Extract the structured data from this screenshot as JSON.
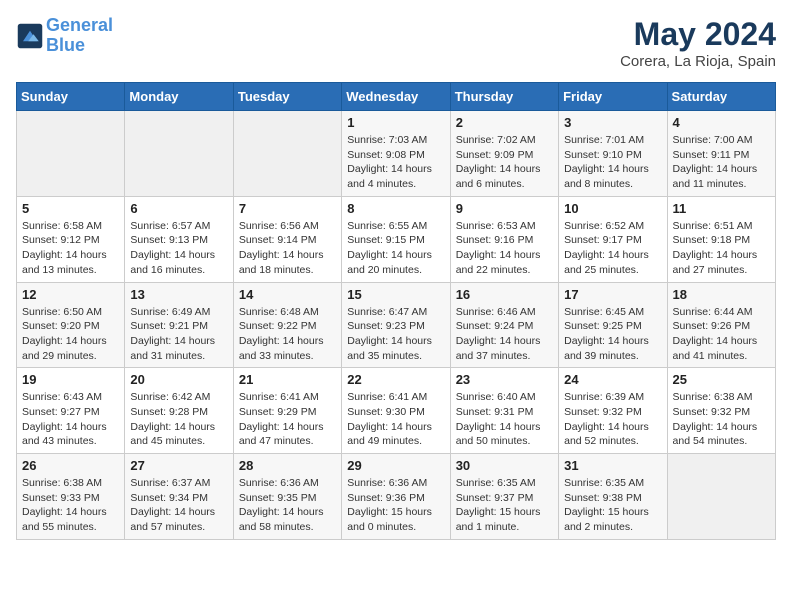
{
  "header": {
    "logo_line1": "General",
    "logo_line2": "Blue",
    "title": "May 2024",
    "location": "Corera, La Rioja, Spain"
  },
  "weekdays": [
    "Sunday",
    "Monday",
    "Tuesday",
    "Wednesday",
    "Thursday",
    "Friday",
    "Saturday"
  ],
  "weeks": [
    [
      {
        "day": "",
        "sunrise": "",
        "sunset": "",
        "daylight": ""
      },
      {
        "day": "",
        "sunrise": "",
        "sunset": "",
        "daylight": ""
      },
      {
        "day": "",
        "sunrise": "",
        "sunset": "",
        "daylight": ""
      },
      {
        "day": "1",
        "sunrise": "Sunrise: 7:03 AM",
        "sunset": "Sunset: 9:08 PM",
        "daylight": "Daylight: 14 hours and 4 minutes."
      },
      {
        "day": "2",
        "sunrise": "Sunrise: 7:02 AM",
        "sunset": "Sunset: 9:09 PM",
        "daylight": "Daylight: 14 hours and 6 minutes."
      },
      {
        "day": "3",
        "sunrise": "Sunrise: 7:01 AM",
        "sunset": "Sunset: 9:10 PM",
        "daylight": "Daylight: 14 hours and 8 minutes."
      },
      {
        "day": "4",
        "sunrise": "Sunrise: 7:00 AM",
        "sunset": "Sunset: 9:11 PM",
        "daylight": "Daylight: 14 hours and 11 minutes."
      }
    ],
    [
      {
        "day": "5",
        "sunrise": "Sunrise: 6:58 AM",
        "sunset": "Sunset: 9:12 PM",
        "daylight": "Daylight: 14 hours and 13 minutes."
      },
      {
        "day": "6",
        "sunrise": "Sunrise: 6:57 AM",
        "sunset": "Sunset: 9:13 PM",
        "daylight": "Daylight: 14 hours and 16 minutes."
      },
      {
        "day": "7",
        "sunrise": "Sunrise: 6:56 AM",
        "sunset": "Sunset: 9:14 PM",
        "daylight": "Daylight: 14 hours and 18 minutes."
      },
      {
        "day": "8",
        "sunrise": "Sunrise: 6:55 AM",
        "sunset": "Sunset: 9:15 PM",
        "daylight": "Daylight: 14 hours and 20 minutes."
      },
      {
        "day": "9",
        "sunrise": "Sunrise: 6:53 AM",
        "sunset": "Sunset: 9:16 PM",
        "daylight": "Daylight: 14 hours and 22 minutes."
      },
      {
        "day": "10",
        "sunrise": "Sunrise: 6:52 AM",
        "sunset": "Sunset: 9:17 PM",
        "daylight": "Daylight: 14 hours and 25 minutes."
      },
      {
        "day": "11",
        "sunrise": "Sunrise: 6:51 AM",
        "sunset": "Sunset: 9:18 PM",
        "daylight": "Daylight: 14 hours and 27 minutes."
      }
    ],
    [
      {
        "day": "12",
        "sunrise": "Sunrise: 6:50 AM",
        "sunset": "Sunset: 9:20 PM",
        "daylight": "Daylight: 14 hours and 29 minutes."
      },
      {
        "day": "13",
        "sunrise": "Sunrise: 6:49 AM",
        "sunset": "Sunset: 9:21 PM",
        "daylight": "Daylight: 14 hours and 31 minutes."
      },
      {
        "day": "14",
        "sunrise": "Sunrise: 6:48 AM",
        "sunset": "Sunset: 9:22 PM",
        "daylight": "Daylight: 14 hours and 33 minutes."
      },
      {
        "day": "15",
        "sunrise": "Sunrise: 6:47 AM",
        "sunset": "Sunset: 9:23 PM",
        "daylight": "Daylight: 14 hours and 35 minutes."
      },
      {
        "day": "16",
        "sunrise": "Sunrise: 6:46 AM",
        "sunset": "Sunset: 9:24 PM",
        "daylight": "Daylight: 14 hours and 37 minutes."
      },
      {
        "day": "17",
        "sunrise": "Sunrise: 6:45 AM",
        "sunset": "Sunset: 9:25 PM",
        "daylight": "Daylight: 14 hours and 39 minutes."
      },
      {
        "day": "18",
        "sunrise": "Sunrise: 6:44 AM",
        "sunset": "Sunset: 9:26 PM",
        "daylight": "Daylight: 14 hours and 41 minutes."
      }
    ],
    [
      {
        "day": "19",
        "sunrise": "Sunrise: 6:43 AM",
        "sunset": "Sunset: 9:27 PM",
        "daylight": "Daylight: 14 hours and 43 minutes."
      },
      {
        "day": "20",
        "sunrise": "Sunrise: 6:42 AM",
        "sunset": "Sunset: 9:28 PM",
        "daylight": "Daylight: 14 hours and 45 minutes."
      },
      {
        "day": "21",
        "sunrise": "Sunrise: 6:41 AM",
        "sunset": "Sunset: 9:29 PM",
        "daylight": "Daylight: 14 hours and 47 minutes."
      },
      {
        "day": "22",
        "sunrise": "Sunrise: 6:41 AM",
        "sunset": "Sunset: 9:30 PM",
        "daylight": "Daylight: 14 hours and 49 minutes."
      },
      {
        "day": "23",
        "sunrise": "Sunrise: 6:40 AM",
        "sunset": "Sunset: 9:31 PM",
        "daylight": "Daylight: 14 hours and 50 minutes."
      },
      {
        "day": "24",
        "sunrise": "Sunrise: 6:39 AM",
        "sunset": "Sunset: 9:32 PM",
        "daylight": "Daylight: 14 hours and 52 minutes."
      },
      {
        "day": "25",
        "sunrise": "Sunrise: 6:38 AM",
        "sunset": "Sunset: 9:32 PM",
        "daylight": "Daylight: 14 hours and 54 minutes."
      }
    ],
    [
      {
        "day": "26",
        "sunrise": "Sunrise: 6:38 AM",
        "sunset": "Sunset: 9:33 PM",
        "daylight": "Daylight: 14 hours and 55 minutes."
      },
      {
        "day": "27",
        "sunrise": "Sunrise: 6:37 AM",
        "sunset": "Sunset: 9:34 PM",
        "daylight": "Daylight: 14 hours and 57 minutes."
      },
      {
        "day": "28",
        "sunrise": "Sunrise: 6:36 AM",
        "sunset": "Sunset: 9:35 PM",
        "daylight": "Daylight: 14 hours and 58 minutes."
      },
      {
        "day": "29",
        "sunrise": "Sunrise: 6:36 AM",
        "sunset": "Sunset: 9:36 PM",
        "daylight": "Daylight: 15 hours and 0 minutes."
      },
      {
        "day": "30",
        "sunrise": "Sunrise: 6:35 AM",
        "sunset": "Sunset: 9:37 PM",
        "daylight": "Daylight: 15 hours and 1 minute."
      },
      {
        "day": "31",
        "sunrise": "Sunrise: 6:35 AM",
        "sunset": "Sunset: 9:38 PM",
        "daylight": "Daylight: 15 hours and 2 minutes."
      },
      {
        "day": "",
        "sunrise": "",
        "sunset": "",
        "daylight": ""
      }
    ]
  ]
}
